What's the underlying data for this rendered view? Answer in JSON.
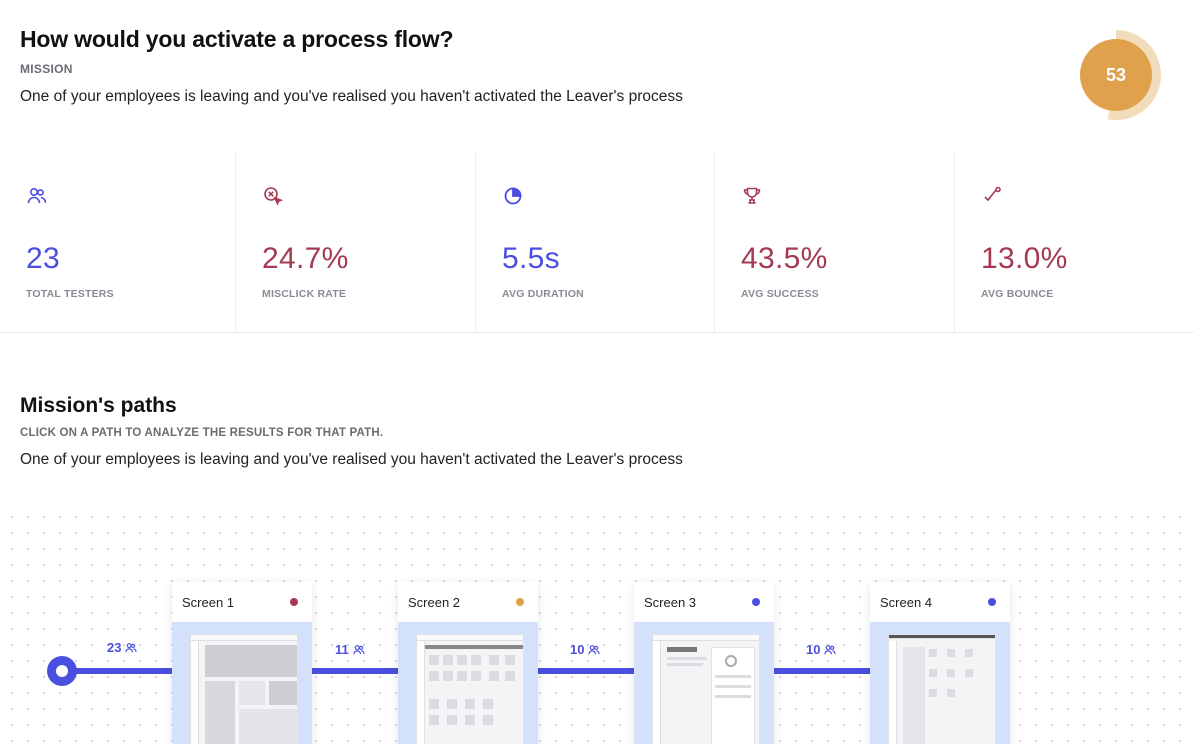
{
  "mission": {
    "title": "How would you activate a process flow?",
    "caption": "MISSION",
    "description": "One of your employees is leaving and you've realised you haven't activated the Leaver's process",
    "score": "53",
    "score_color": "#e0a14d"
  },
  "stats": [
    {
      "value": "23",
      "label": "TOTAL TESTERS",
      "icon": "users-icon",
      "color": "#4b4fe0"
    },
    {
      "value": "24.7%",
      "label": "MISCLICK RATE",
      "icon": "misclick-icon",
      "color": "#a53a52"
    },
    {
      "value": "5.5s",
      "label": "AVG DURATION",
      "icon": "pie-clock-icon",
      "color": "#4b4fe0"
    },
    {
      "value": "43.5%",
      "label": "AVG SUCCESS",
      "icon": "trophy-icon",
      "color": "#a53a52"
    },
    {
      "value": "13.0%",
      "label": "AVG BOUNCE",
      "icon": "bounce-icon",
      "color": "#a53a52"
    }
  ],
  "paths": {
    "title": "Mission's paths",
    "caption": "CLICK ON A PATH TO ANALYZE THE RESULTS FOR THAT PATH.",
    "description": "One of your employees is leaving and you've realised you haven't activated the Leaver's process",
    "counts": [
      "23",
      "11",
      "10",
      "10"
    ],
    "screens": [
      {
        "name": "Screen 1",
        "dot_color": "#a53a52"
      },
      {
        "name": "Screen 2",
        "dot_color": "#e0a14d"
      },
      {
        "name": "Screen 3",
        "dot_color": "#4b4fe0"
      },
      {
        "name": "Screen 4",
        "dot_color": "#4b4fe0"
      }
    ]
  }
}
